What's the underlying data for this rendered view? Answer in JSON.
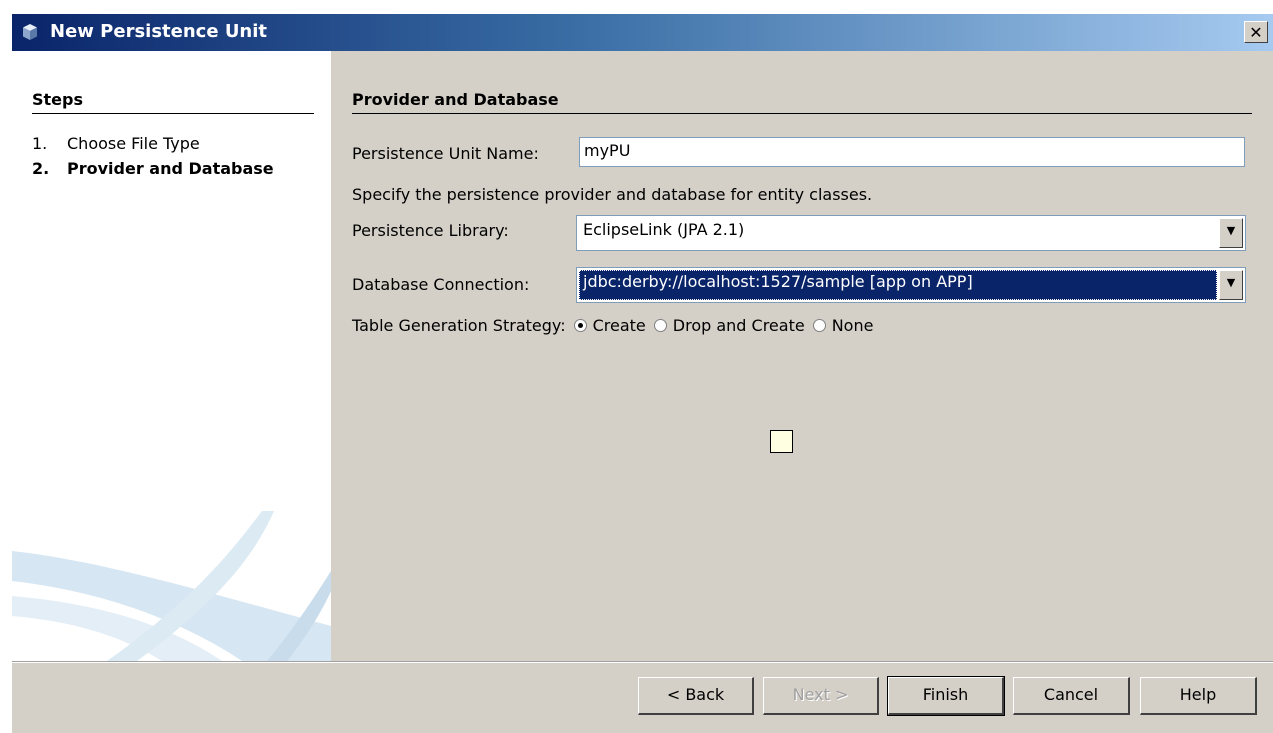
{
  "window": {
    "title": "New Persistence Unit",
    "close_glyph": "✕",
    "icon": "cube-icon"
  },
  "steps": {
    "heading": "Steps",
    "items": [
      {
        "num": "1.",
        "label": "Choose File Type"
      },
      {
        "num": "2.",
        "label": "Provider and Database"
      }
    ]
  },
  "panel": {
    "heading": "Provider and Database",
    "unit_name_label": "Persistence Unit Name:",
    "unit_name_value": "myPU",
    "description": "Specify the persistence provider and database for entity classes.",
    "library_label": "Persistence Library:",
    "library_value": "EclipseLink (JPA 2.1)",
    "connection_label": "Database Connection:",
    "connection_value": "jdbc:derby://localhost:1527/sample [app on APP]",
    "strategy_label": "Table Generation Strategy:",
    "strategy_options": [
      "Create",
      "Drop and Create",
      "None"
    ],
    "strategy_selected": "Create"
  },
  "buttons": {
    "back": "< Back",
    "next": "Next >",
    "finish": "Finish",
    "cancel": "Cancel",
    "help": "Help"
  },
  "colors": {
    "title_start": "#0a246a",
    "title_end": "#a6caf0",
    "dialog_bg": "#d4d0c8",
    "selection": "#0a246a"
  }
}
